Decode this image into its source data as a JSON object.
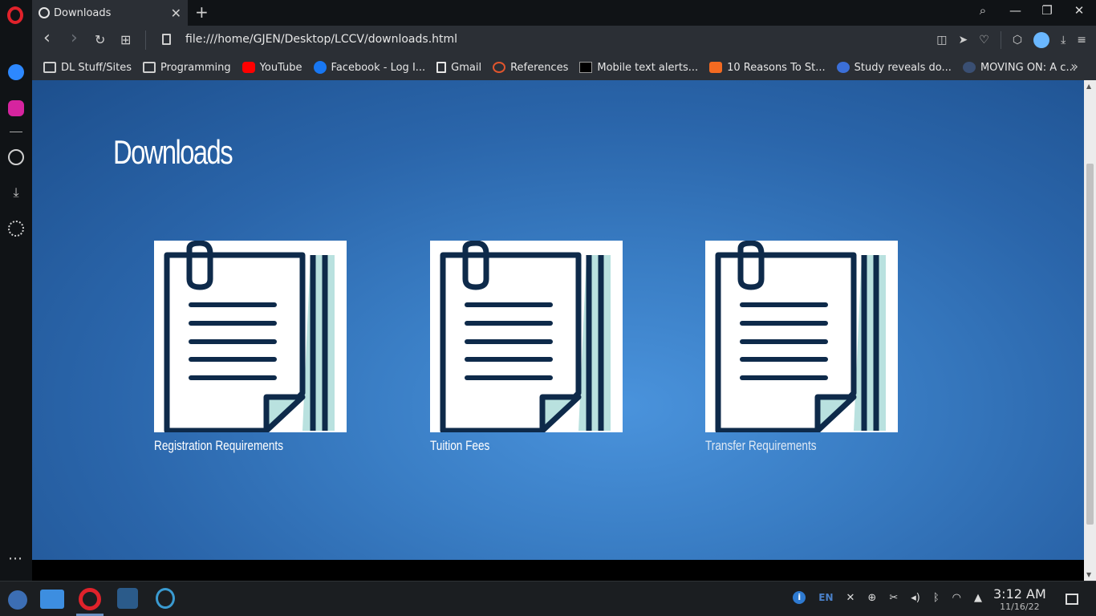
{
  "browser": {
    "tab": {
      "title": "Downloads",
      "close_symbol": "✕"
    },
    "new_tab_symbol": "+",
    "address": {
      "url": "file:///home/GJEN/Desktop/LCCV/downloads.html"
    },
    "window_controls": {
      "search": "⌕",
      "minimize": "—",
      "restore": "❐",
      "close": "✕"
    },
    "nav": {
      "back": "‹",
      "forward": "›",
      "reload": "↻",
      "tabs_grid": "⊞"
    },
    "bookmarks": [
      {
        "label": "DL Stuff/Sites",
        "icon": "folder-icon"
      },
      {
        "label": "Programming",
        "icon": "folder-icon"
      },
      {
        "label": "YouTube",
        "icon": "youtube-icon"
      },
      {
        "label": "Facebook - Log I...",
        "icon": "facebook-icon"
      },
      {
        "label": "Gmail",
        "icon": "document-icon"
      },
      {
        "label": "References",
        "icon": "graduation-cap-icon"
      },
      {
        "label": "Mobile text alerts...",
        "icon": "w-logo-icon"
      },
      {
        "label": "10 Reasons To St...",
        "icon": "checkmark-icon"
      },
      {
        "label": "Study reveals do...",
        "icon": "inq-logo-icon"
      },
      {
        "label": "MOVING ON: A c...",
        "icon": "seal-icon"
      }
    ],
    "bookmarks_more_symbol": "»"
  },
  "page": {
    "title": "Downloads",
    "cards": [
      {
        "label": "Registration Requirements",
        "icon": "document-clip-icon"
      },
      {
        "label": "Tuition Fees",
        "icon": "document-clip-icon"
      },
      {
        "label": "Transfer Requirements",
        "icon": "document-clip-icon"
      }
    ]
  },
  "taskbar": {
    "tray": {
      "info": "i",
      "language": "EN"
    },
    "clock": {
      "time": "3:12 AM",
      "date": "11/16/22"
    }
  },
  "colors": {
    "page_bg_center": "#4a93dc",
    "page_bg_edge": "#1d4f8d",
    "icon_dark": "#0e2a4a",
    "icon_teal": "#b9e1df",
    "opera_red": "#e0222b"
  }
}
